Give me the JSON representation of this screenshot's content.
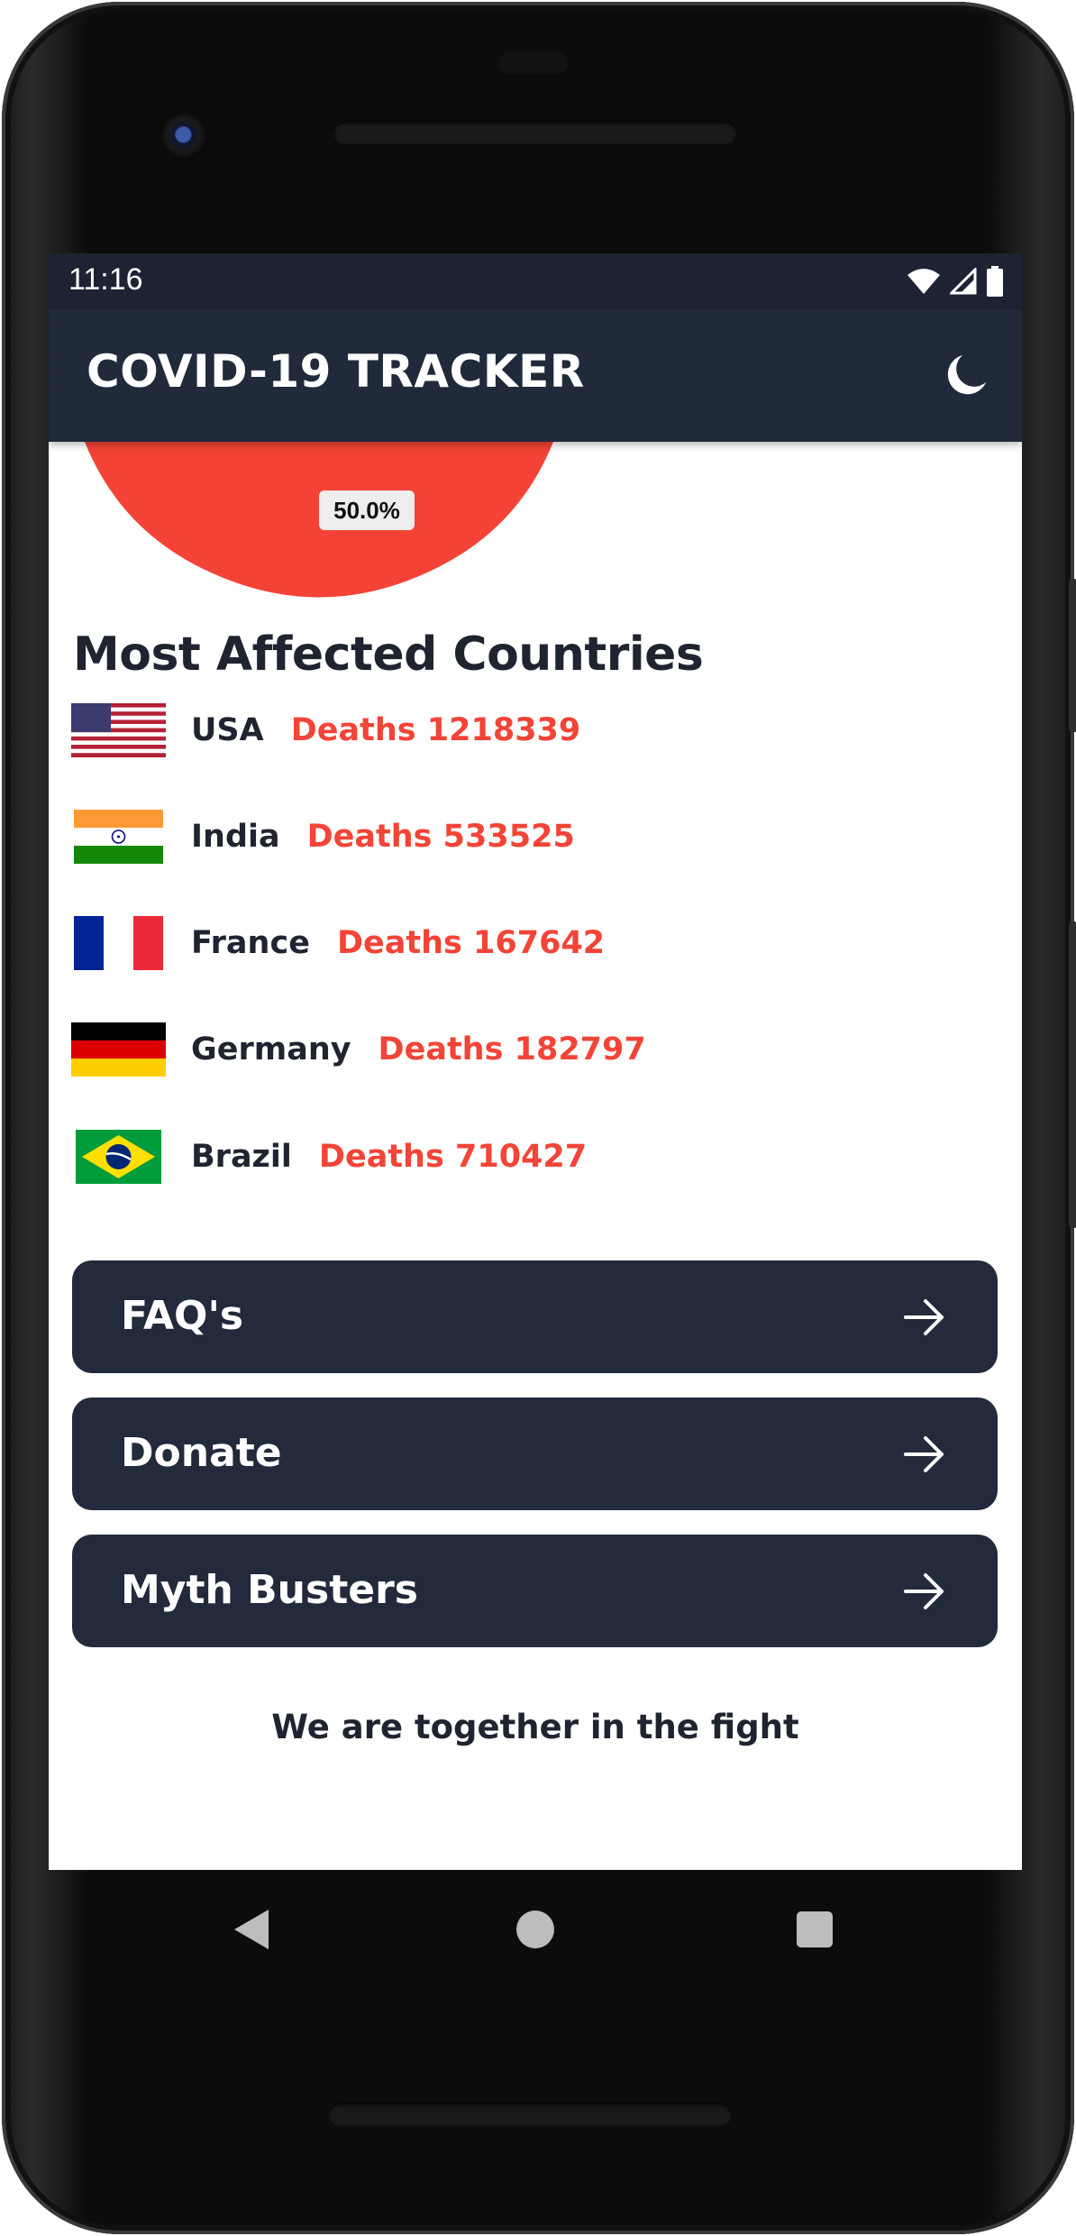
{
  "status_bar": {
    "time": "11:16"
  },
  "app_bar": {
    "title": "COVID-19 TRACKER",
    "theme_icon": "moon-icon"
  },
  "pie": {
    "label": "50.0%",
    "color": "#f44336"
  },
  "section": {
    "title": "Most Affected Countries"
  },
  "countries": [
    {
      "name": "USA",
      "deaths": "Deaths 1218339",
      "flag": "usa-flag-icon"
    },
    {
      "name": "India",
      "deaths": "Deaths 533525",
      "flag": "india-flag-icon"
    },
    {
      "name": "France",
      "deaths": "Deaths 167642",
      "flag": "france-flag-icon"
    },
    {
      "name": "Germany",
      "deaths": "Deaths 182797",
      "flag": "germany-flag-icon"
    },
    {
      "name": "Brazil",
      "deaths": "Deaths 710427",
      "flag": "brazil-flag-icon"
    }
  ],
  "menu": [
    {
      "label": "FAQ's",
      "icon": "arrow-right-icon"
    },
    {
      "label": "Donate",
      "icon": "arrow-right-icon"
    },
    {
      "label": "Myth Busters",
      "icon": "arrow-right-icon"
    }
  ],
  "footer": {
    "text": "We are together in the fight"
  },
  "colors": {
    "header": "#212a3a",
    "accent": "#f24437",
    "button": "#222a3b"
  },
  "nav": {
    "back_icon": "back-triangle-icon",
    "home_icon": "home-circle-icon",
    "recents_icon": "recents-square-icon"
  }
}
